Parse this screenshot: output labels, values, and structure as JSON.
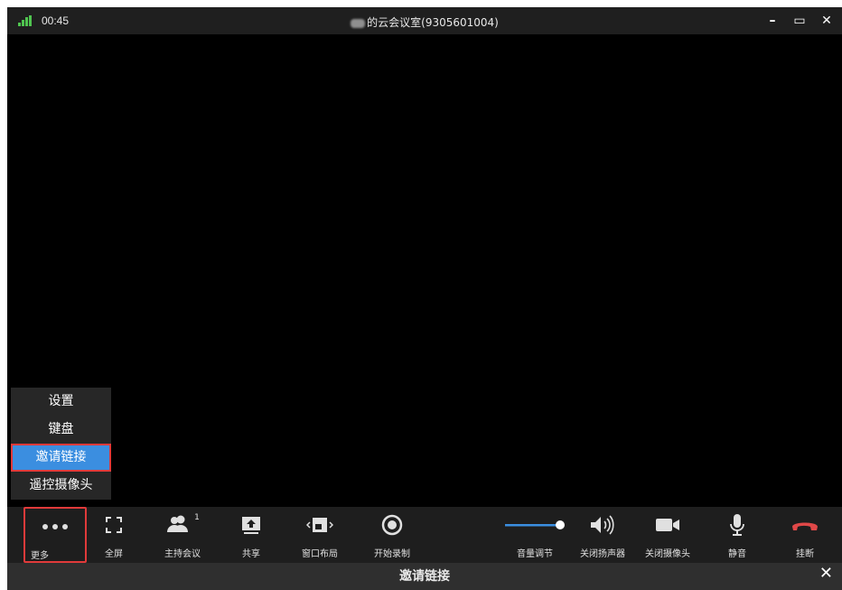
{
  "titlebar": {
    "time": "00:45",
    "title": "的云会议室(9305601004)",
    "minimize_glyph": "–",
    "maximize_glyph": "▭",
    "close_glyph": "✕"
  },
  "menu": {
    "items": [
      {
        "label": "设置"
      },
      {
        "label": "键盘"
      },
      {
        "label": "邀请链接",
        "selected": true
      },
      {
        "label": "遥控摄像头"
      }
    ]
  },
  "toolbar": {
    "more": "更多",
    "fullscreen": "全屏",
    "host": "主持会议",
    "host_badge": "1",
    "share": "共享",
    "layout": "窗口布局",
    "record": "开始录制",
    "volume": "音量调节",
    "speaker": "关闭扬声器",
    "camera": "关闭摄像头",
    "mute": "静音",
    "hangup": "挂断"
  },
  "dialog": {
    "title": "邀请链接",
    "close_glyph": "✕"
  },
  "colors": {
    "signal": "#4fc44f",
    "menu_selected": "#3b8ee0",
    "highlight_border": "#e03a3a",
    "hangup": "#e04848"
  }
}
